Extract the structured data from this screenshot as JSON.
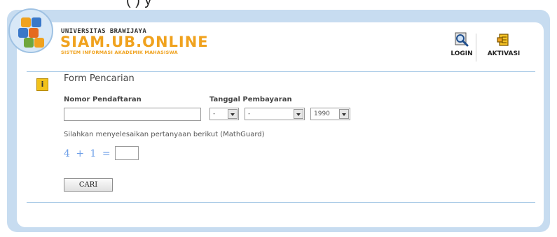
{
  "top_caption": "(    )          y",
  "brand": {
    "university": "UNIVERSITAS BRAWIJAYA",
    "name": "SIAM.UB.ONLINE",
    "subtitle": "SISTEM INFORMASI AKADEMIK MAHASISWA",
    "accent_color": "#f0a21e"
  },
  "nav": {
    "login_label": "LOGIN",
    "login_icon": "magnifier-icon",
    "aktivasi_label": "AKTIVASI",
    "aktivasi_icon": "activation-icon"
  },
  "form": {
    "title": "Form Pencarian",
    "info_icon_glyph": "i",
    "nomor_label": "Nomor Pendaftaran",
    "nomor_value": "",
    "tanggal_label": "Tanggal Pembayaran",
    "day_value": "-",
    "month_value": "-",
    "year_value": "1990",
    "mathguard_note": "Silahkan menyelesaikan pertanyaan berikut (MathGuard)",
    "captcha_expression": "4 + 1 =",
    "captcha_answer": "",
    "submit_label": "CARI"
  },
  "colors": {
    "frame_bg": "#c7dcf0",
    "divider": "#a7c9e6",
    "info_icon": "#f2c21a"
  }
}
